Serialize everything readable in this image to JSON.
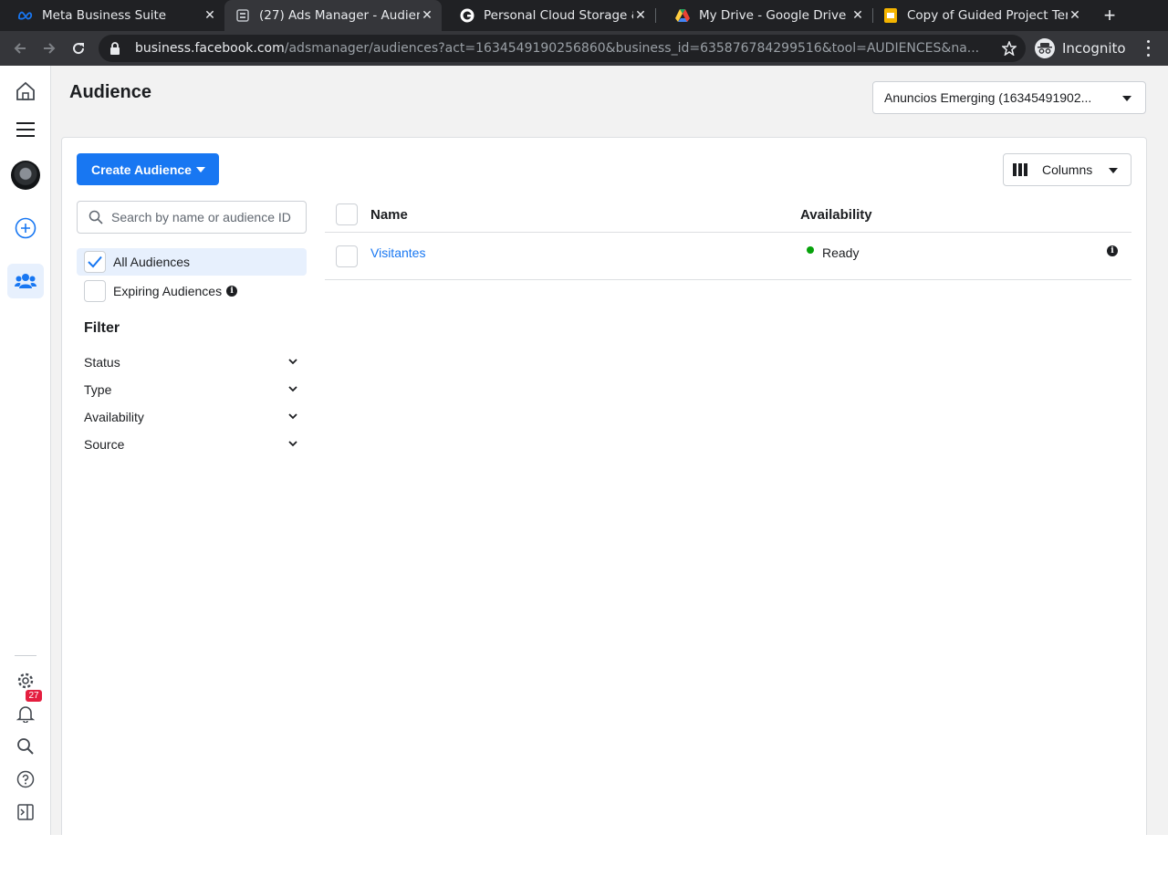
{
  "browser": {
    "tabs": [
      {
        "title": "Meta Business Suite",
        "favicon": "meta-icon"
      },
      {
        "title": "(27) Ads Manager - Audien",
        "favicon": "ads-manager-icon"
      },
      {
        "title": "Personal Cloud Storage & F",
        "favicon": "google-icon"
      },
      {
        "title": "My Drive - Google Drive",
        "favicon": "google-drive-icon"
      },
      {
        "title": "Copy of Guided Project Ter",
        "favicon": "google-slides-icon"
      }
    ],
    "url_host": "business.facebook.com",
    "url_rest": "/adsmanager/audiences?act=1634549190256860&business_id=635876784299516&tool=AUDIENCES&na...",
    "incognito_label": "Incognito"
  },
  "rail": {
    "notification_count": "27",
    "icons": [
      "home-icon",
      "menu-icon",
      "avatar",
      "add-icon",
      "audiences-icon",
      "settings-icon",
      "bell-icon",
      "search-icon",
      "help-icon",
      "sidebar-toggle-icon"
    ]
  },
  "header": {
    "title": "Audience",
    "account": "Anuncios Emerging (16345491902..."
  },
  "toolbar": {
    "create_label": "Create Audience",
    "columns_label": "Columns"
  },
  "sidebar": {
    "search_placeholder": "Search by name or audience ID",
    "options": [
      {
        "label": "All Audiences",
        "checked": true
      },
      {
        "label": "Expiring Audiences",
        "checked": false
      }
    ],
    "filter_heading": "Filter",
    "filters": [
      "Status",
      "Type",
      "Availability",
      "Source"
    ]
  },
  "table": {
    "headers": {
      "name": "Name",
      "availability": "Availability"
    },
    "rows": [
      {
        "name": "Visitantes",
        "availability": "Ready"
      }
    ]
  },
  "colors": {
    "brand_blue": "#1877f2",
    "ready_green": "#06a20b",
    "notification_red": "#e41e3f"
  }
}
